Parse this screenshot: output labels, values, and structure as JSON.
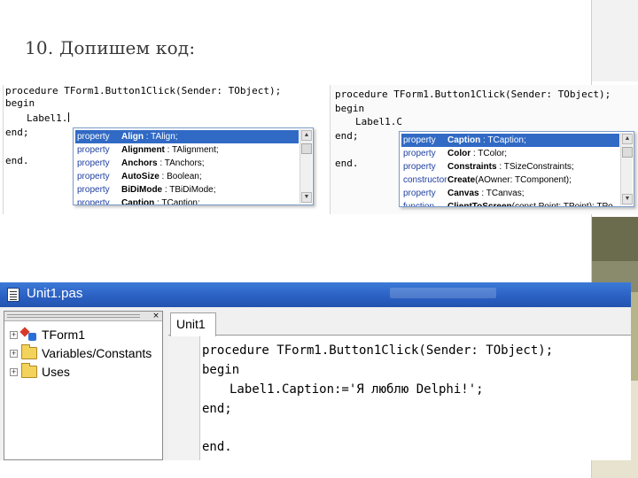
{
  "slide": {
    "title": "10. Допишем код:"
  },
  "snippet1": {
    "lines": [
      "procedure TForm1.Button1Click(Sender: TObject);",
      "begin",
      "Label1.",
      "end;",
      "end."
    ],
    "popup": [
      {
        "kind": "property",
        "name": "Align",
        "type": " : TAlign;"
      },
      {
        "kind": "property",
        "name": "Alignment",
        "type": " : TAlignment;"
      },
      {
        "kind": "property",
        "name": "Anchors",
        "type": " : TAnchors;"
      },
      {
        "kind": "property",
        "name": "AutoSize",
        "type": " : Boolean;"
      },
      {
        "kind": "property",
        "name": "BiDiMode",
        "type": " : TBiDiMode;"
      },
      {
        "kind": "property",
        "name": "Caption",
        "type": " : TCaption;"
      }
    ],
    "selected_index": 0
  },
  "snippet2": {
    "lines": [
      "procedure TForm1.Button1Click(Sender: TObject);",
      "begin",
      "Label1.C",
      "end;",
      "end."
    ],
    "popup": [
      {
        "kind": "property",
        "name": "Caption",
        "type": " : TCaption;"
      },
      {
        "kind": "property",
        "name": "Color",
        "type": " : TColor;"
      },
      {
        "kind": "property",
        "name": "Constraints",
        "type": " : TSizeConstraints;"
      },
      {
        "kind": "constructor",
        "name": "Create",
        "type": "(AOwner: TComponent);"
      },
      {
        "kind": "property",
        "name": "Canvas",
        "type": " : TCanvas;"
      },
      {
        "kind": "function",
        "name": "ClientToScreen",
        "type": "(const Point: TPoint): TPo"
      }
    ],
    "selected_index": 0
  },
  "ide": {
    "window_title": "Unit1.pas",
    "close_glyph": "×",
    "tree": [
      {
        "label": "TForm1",
        "icon": "class-icon"
      },
      {
        "label": "Variables/Constants",
        "icon": "folder-icon"
      },
      {
        "label": "Uses",
        "icon": "folder-icon"
      }
    ],
    "tab_label": "Unit1",
    "code": [
      "procedure TForm1.Button1Click(Sender: TObject);",
      "begin",
      "Label1.Caption:='Я люблю Delphi!';",
      "end;",
      "",
      "end."
    ]
  },
  "colors": {
    "titlebar": "#2a5fc1",
    "selection": "#316ac5",
    "keyword_blue": "#1f3fa0"
  }
}
